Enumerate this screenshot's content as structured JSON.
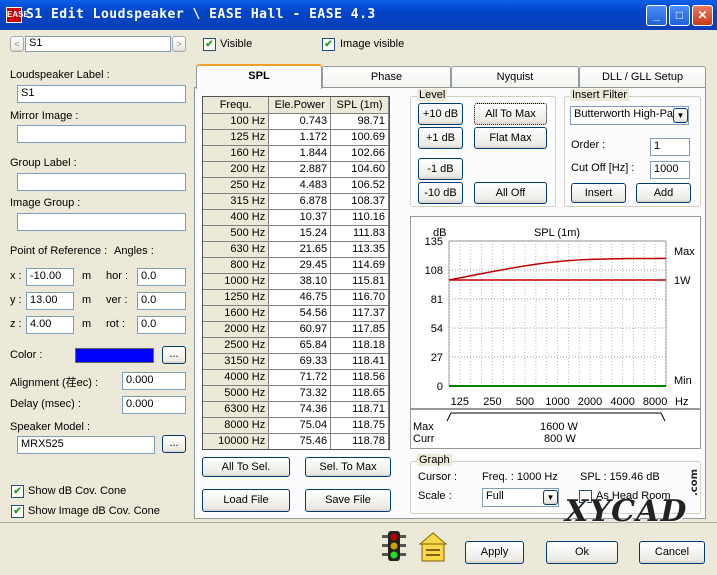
{
  "window": {
    "title": "S1 Edit Loudspeaker \\ EASE Hall - EASE 4.3",
    "app_icon_text": "EASE"
  },
  "top": {
    "nav_value": "S1",
    "visible_label": "Visible",
    "visible_checked": true,
    "image_visible_label": "Image visible",
    "image_visible_checked": true
  },
  "left": {
    "speaker_label_title": "Loudspeaker Label :",
    "speaker_label_value": "S1",
    "mirror_image_title": "Mirror Image :",
    "mirror_image_value": "",
    "group_label_title": "Group Label :",
    "group_label_value": "",
    "image_group_title": "Image Group :",
    "image_group_value": "",
    "point_ref_title": "Point of Reference :",
    "angles_title": "Angles :",
    "x_label": "x :",
    "x_value": "-10.00",
    "y_label": "y :",
    "y_value": "13.00",
    "z_label": "z :",
    "z_value": "4.00",
    "unit_m": "m",
    "hor_label": "hor :",
    "hor_value": "0.0",
    "ver_label": "ver :",
    "ver_value": "0.0",
    "rot_label": "rot :",
    "rot_value": "0.0",
    "color_label": "Color :",
    "color_value": "#0000FF",
    "ellipsis": "...",
    "alignment_label": "Alignment (荏ec) :",
    "alignment_value": "0.000",
    "delay_label": "Delay (msec) :",
    "delay_value": "0.000",
    "speaker_model_label": "Speaker Model :",
    "speaker_model_value": "MRX525",
    "show_db_cov_label": "Show dB Cov. Cone",
    "show_db_cov_checked": true,
    "show_image_db_cov_label": "Show Image dB Cov. Cone",
    "show_image_db_cov_checked": true
  },
  "tabs": [
    {
      "label": "SPL",
      "active": true
    },
    {
      "label": "Phase",
      "active": false
    },
    {
      "label": "Nyquist",
      "active": false
    },
    {
      "label": "DLL / GLL Setup",
      "active": false
    }
  ],
  "table": {
    "headers": [
      "Frequ.",
      "Ele.Power",
      "SPL (1m)"
    ],
    "rows": [
      [
        "100 Hz",
        "0.743",
        "98.71"
      ],
      [
        "125 Hz",
        "1.172",
        "100.69"
      ],
      [
        "160 Hz",
        "1.844",
        "102.66"
      ],
      [
        "200 Hz",
        "2.887",
        "104.60"
      ],
      [
        "250 Hz",
        "4.483",
        "106.52"
      ],
      [
        "315 Hz",
        "6.878",
        "108.37"
      ],
      [
        "400 Hz",
        "10.37",
        "110.16"
      ],
      [
        "500 Hz",
        "15.24",
        "111.83"
      ],
      [
        "630 Hz",
        "21.65",
        "113.35"
      ],
      [
        "800 Hz",
        "29.45",
        "114.69"
      ],
      [
        "1000 Hz",
        "38.10",
        "115.81"
      ],
      [
        "1250 Hz",
        "46.75",
        "116.70"
      ],
      [
        "1600 Hz",
        "54.56",
        "117.37"
      ],
      [
        "2000 Hz",
        "60.97",
        "117.85"
      ],
      [
        "2500 Hz",
        "65.84",
        "118.18"
      ],
      [
        "3150 Hz",
        "69.33",
        "118.41"
      ],
      [
        "4000 Hz",
        "71.72",
        "118.56"
      ],
      [
        "5000 Hz",
        "73.32",
        "118.65"
      ],
      [
        "6300 Hz",
        "74.36",
        "118.71"
      ],
      [
        "8000 Hz",
        "75.04",
        "118.75"
      ],
      [
        "10000 Hz",
        "75.46",
        "118.78"
      ]
    ],
    "all_to_sel": "All To Sel.",
    "sel_to_max": "Sel. To Max",
    "load_file": "Load File",
    "save_file": "Save File"
  },
  "level": {
    "title": "Level",
    "plus10": "+10 dB",
    "all_to_max": "All To Max",
    "plus1": "+1 dB",
    "flat_max": "Flat Max",
    "minus1": "-1 dB",
    "minus10": "-10 dB",
    "all_off": "All Off"
  },
  "insert_filter": {
    "title": "Insert Filter",
    "filter_type": "Butterworth High-Pass",
    "order_label": "Order :",
    "order_value": "1",
    "cutoff_label": "Cut Off [Hz] :",
    "cutoff_value": "1000",
    "insert": "Insert",
    "add": "Add"
  },
  "graph_settings": {
    "title": "Graph",
    "cursor_label": "Cursor :",
    "freq_text": "Freq. : 1000 Hz",
    "spl_text": "SPL : 159.46 dB",
    "scale_label": "Scale :",
    "scale_value": "Full",
    "as_head_room_label": "As Head Room",
    "as_head_room_checked": false
  },
  "power": {
    "max_label": "Max",
    "curr_label": "Curr",
    "max_value": "1600 W",
    "curr_value": "800 W"
  },
  "bottom": {
    "apply": "Apply",
    "ok": "Ok",
    "cancel": "Cancel",
    "watermark": "XYCAD",
    "watermark_suffix": ".com"
  },
  "chart_data": {
    "type": "line",
    "title": "SPL (1m)",
    "ylabel": "dB",
    "x": [
      "100 Hz",
      "125 Hz",
      "160 Hz",
      "200 Hz",
      "250 Hz",
      "315 Hz",
      "400 Hz",
      "500 Hz",
      "630 Hz",
      "800 Hz",
      "1000 Hz",
      "1250 Hz",
      "1600 Hz",
      "2000 Hz",
      "2500 Hz",
      "3150 Hz",
      "4000 Hz",
      "5000 Hz",
      "6300 Hz",
      "8000 Hz",
      "10000 Hz"
    ],
    "xticks": [
      "125",
      "250",
      "500",
      "1000",
      "2000",
      "4000",
      "8000"
    ],
    "xunit": "Hz",
    "yticks": [
      0,
      27,
      54,
      81,
      108,
      135
    ],
    "ylim": [
      0,
      135
    ],
    "right_labels": [
      "Max",
      "1W",
      "Min"
    ],
    "series": [
      {
        "color": "#C00000",
        "values": [
          98.71,
          100.69,
          102.66,
          104.6,
          106.52,
          108.37,
          110.16,
          111.83,
          113.35,
          114.69,
          115.81,
          116.7,
          117.37,
          117.85,
          118.18,
          118.41,
          118.56,
          118.65,
          118.71,
          118.75,
          118.78
        ]
      },
      {
        "color": "#C00000",
        "values": [
          98.7,
          98.7,
          98.7,
          98.7,
          98.7,
          98.7,
          98.7,
          98.7,
          98.7,
          98.7,
          98.7,
          98.7,
          98.7,
          98.7,
          98.7,
          98.7,
          98.7,
          98.7,
          98.7,
          98.7,
          98.7
        ]
      },
      {
        "color": "#008000",
        "values": [
          0,
          0,
          0,
          0,
          0,
          0,
          0,
          0,
          0,
          0,
          0,
          0,
          0,
          0,
          0,
          0,
          0,
          0,
          0,
          0,
          0
        ]
      }
    ],
    "grid": true
  }
}
